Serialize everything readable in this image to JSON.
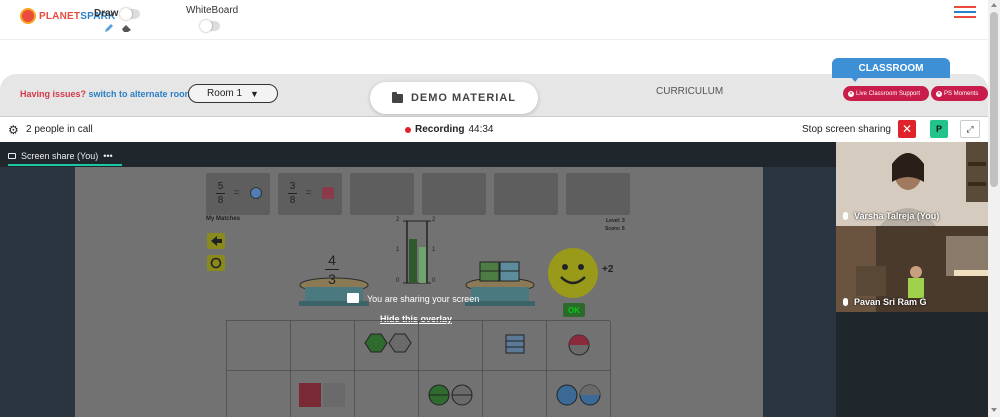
{
  "header": {
    "logo_part1": "PLANET",
    "logo_part2": "SPARK",
    "draw_label": "Draw",
    "whiteboard_label": "WhiteBoard"
  },
  "toolbar": {
    "issues_text": "Having issues?",
    "switch_link": "switch to alternate room",
    "room_value": "Room 1",
    "demo_material": "DEMO MATERIAL",
    "curriculum": "CURRICULUM",
    "classroom_tab": "CLASSROOM",
    "live_support": "Live Classroom Support",
    "ps_moments": "PS Moments"
  },
  "call": {
    "people_count": "2 people in call",
    "recording_label": "Recording",
    "recording_time": "44:34",
    "stop_share_label": "Stop screen sharing",
    "stop_icon": "✕",
    "participant_initial": "P",
    "expand_icon": "⤢"
  },
  "share": {
    "tab_label": "Screen share (You)",
    "tab_more": "•••",
    "overlay_text": "You are sharing your screen",
    "hide_overlay": "Hide this overlay"
  },
  "game": {
    "card1": {
      "num": "5",
      "den": "8"
    },
    "card2": {
      "num": "3",
      "den": "8"
    },
    "equals": "=",
    "my_matches": "My Matches",
    "level": "Level: 3",
    "score": "Score: 6",
    "big_frac": {
      "num": "4",
      "den": "3"
    },
    "scale_top": "2",
    "scale_mid": "1",
    "scale_bottom": "0",
    "plus_points": "+2",
    "ok": "OK"
  },
  "participants": [
    {
      "name": "Varsha Talreja (You)"
    },
    {
      "name": "Pavan Sri Ram G"
    }
  ],
  "colors": {
    "brand_red": "#e94c3d",
    "brand_blue": "#2a7fc7",
    "classroom_blue": "#3d8fd6",
    "pill_red": "#c81d4a",
    "accent_teal": "#1cc7a6",
    "stop_red": "#e0232a",
    "p_green": "#22c48a"
  }
}
